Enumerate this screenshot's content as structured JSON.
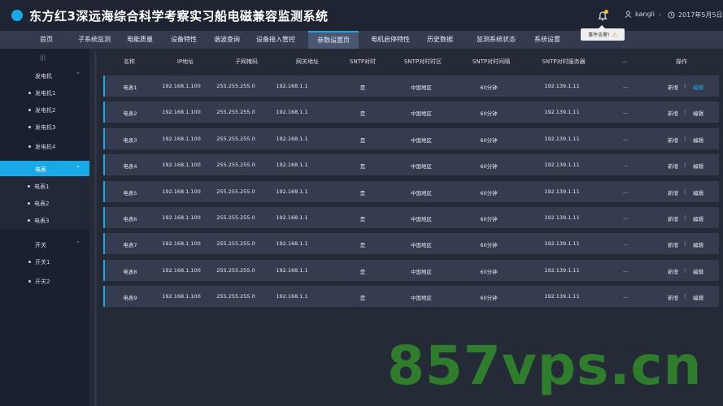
{
  "app": {
    "title": "东方红3深远海综合科学考察实习船电磁兼容监测系统",
    "user": "kangli",
    "date": "2017年5月5日",
    "tooltip": "事件告警!",
    "accent": "#19a9e6"
  },
  "nav": {
    "tabs": [
      {
        "label": "首页"
      },
      {
        "label": "子系统监测"
      },
      {
        "label": "电能质量"
      },
      {
        "label": "设备特性"
      },
      {
        "label": "谐波查询"
      },
      {
        "label": "设备接入管控"
      },
      {
        "label": "参数设置页",
        "active": true
      },
      {
        "label": "电机启停特性"
      },
      {
        "label": "历史数据"
      },
      {
        "label": "监测系统状态"
      },
      {
        "label": "系统设置"
      }
    ]
  },
  "sidebar": {
    "collapse_label": "|||",
    "groups": [
      {
        "label": "发电机",
        "items": [
          "发电机1",
          "发电机2",
          "发电机3",
          "发电机4"
        ]
      },
      {
        "label": "电表",
        "active": true,
        "items": [
          "电表1",
          "电表2",
          "电表3"
        ]
      },
      {
        "label": "开关",
        "items": [
          "开关1",
          "开关2"
        ]
      }
    ]
  },
  "table": {
    "columns": [
      "名称",
      "IP地址",
      "子网掩码",
      "网关地址",
      "SNTP对时",
      "SNTP对时时区",
      "SNTP对时间隔",
      "SNTP对时服务器",
      "...",
      "操作"
    ],
    "rows": [
      {
        "name": "电表1",
        "ip": "192.168.1.100",
        "mask": "255.255.255.0",
        "gateway": "192.168.1.1",
        "sntp": "是",
        "zone": "中国地区",
        "interval": "60分钟",
        "server": "192.139.1.11",
        "more": "...",
        "add": "新增",
        "sep": "|",
        "edit": "编辑"
      },
      {
        "name": "电表2",
        "ip": "192.168.1.100",
        "mask": "255.255.255.0",
        "gateway": "192.168.1.1",
        "sntp": "是",
        "zone": "中国地区",
        "interval": "60分钟",
        "server": "192.139.1.11",
        "more": "...",
        "add": "新增",
        "sep": "|",
        "edit": "编辑"
      },
      {
        "name": "电表3",
        "ip": "192.168.1.100",
        "mask": "255.255.255.0",
        "gateway": "192.168.1.1",
        "sntp": "是",
        "zone": "中国地区",
        "interval": "60分钟",
        "server": "192.139.1.11",
        "more": "...",
        "add": "新增",
        "sep": "|",
        "edit": "编辑"
      },
      {
        "name": "电表4",
        "ip": "192.168.1.100",
        "mask": "255.255.255.0",
        "gateway": "192.168.1.1",
        "sntp": "是",
        "zone": "中国地区",
        "interval": "60分钟",
        "server": "192.139.1.11",
        "more": "...",
        "add": "新增",
        "sep": "|",
        "edit": "编辑"
      },
      {
        "name": "电表5",
        "ip": "192.168.1.100",
        "mask": "255.255.255.0",
        "gateway": "192.168.1.1",
        "sntp": "是",
        "zone": "中国地区",
        "interval": "60分钟",
        "server": "192.139.1.11",
        "more": "...",
        "add": "新增",
        "sep": "|",
        "edit": "编辑"
      },
      {
        "name": "电表6",
        "ip": "192.168.1.100",
        "mask": "255.255.255.0",
        "gateway": "192.168.1.1",
        "sntp": "是",
        "zone": "中国地区",
        "interval": "60分钟",
        "server": "192.139.1.11",
        "more": "...",
        "add": "新增",
        "sep": "|",
        "edit": "编辑"
      },
      {
        "name": "电表7",
        "ip": "192.168.1.100",
        "mask": "255.255.255.0",
        "gateway": "192.168.1.1",
        "sntp": "是",
        "zone": "中国地区",
        "interval": "60分钟",
        "server": "192.139.1.11",
        "more": "...",
        "add": "新增",
        "sep": "|",
        "edit": "编辑"
      },
      {
        "name": "电表8",
        "ip": "192.168.1.100",
        "mask": "255.255.255.0",
        "gateway": "192.168.1.1",
        "sntp": "是",
        "zone": "中国地区",
        "interval": "60分钟",
        "server": "192.139.1.11",
        "more": "...",
        "add": "新增",
        "sep": "|",
        "edit": "编辑"
      },
      {
        "name": "电表9",
        "ip": "192.168.1.100",
        "mask": "255.255.255.0",
        "gateway": "192.168.1.1",
        "sntp": "是",
        "zone": "中国地区",
        "interval": "60分钟",
        "server": "192.139.1.11",
        "more": "...",
        "add": "新增",
        "sep": "|",
        "edit": "编辑"
      }
    ]
  },
  "watermark": "857vps.cn"
}
